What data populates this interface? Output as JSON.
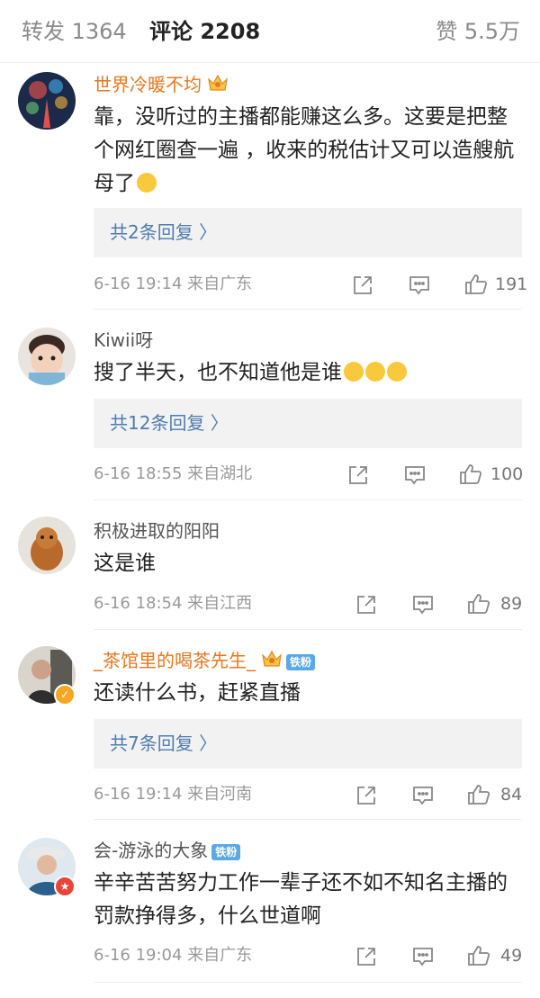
{
  "tabs": {
    "reposts": "转发 1364",
    "comments": "评论 2208",
    "likes": "赞 5.5万"
  },
  "comments": [
    {
      "username": "世界冷暖不均",
      "text": "靠，没听过的主播都能赚这么多。这要是把整个网红圈查一遍 ，收来的税估计又可以造艘航母了",
      "replies": "共2条回复 〉",
      "meta": "6-16 19:14  来自广东",
      "likes": "191"
    },
    {
      "username": "Kiwii呀",
      "text": "搜了半天，也不知道他是谁",
      "replies": "共12条回复 〉",
      "meta": "6-16 18:55  来自湖北",
      "likes": "100"
    },
    {
      "username": "积极进取的阳阳",
      "text": "这是谁",
      "meta": "6-16 18:54  来自江西",
      "likes": "89"
    },
    {
      "username": "_茶馆里的喝茶先生_",
      "badge": "铁粉",
      "text": "还读什么书，赶紧直播",
      "replies": "共7条回复 〉",
      "meta": "6-16 19:14  来自河南",
      "likes": "84"
    },
    {
      "username": "会-游泳的大象",
      "badge": "铁粉",
      "text": "辛辛苦苦努力工作一辈子还不如不知名主播的罚款挣得多，什么世道啊",
      "meta": "6-16 19:04  来自广东",
      "likes": "49"
    }
  ],
  "colors": {
    "vip_name": "#e8761f",
    "reply_link": "#4f7cae",
    "meta_gray": "#999999",
    "reply_bg": "#f2f2f2",
    "fan_badge": "#5ba8e6",
    "verified_badge": "#f5a623"
  },
  "icons": [
    "crown-icon",
    "laugh-cry-emoji",
    "share-icon",
    "comment-icon",
    "like-icon",
    "verified-badge-icon"
  ]
}
